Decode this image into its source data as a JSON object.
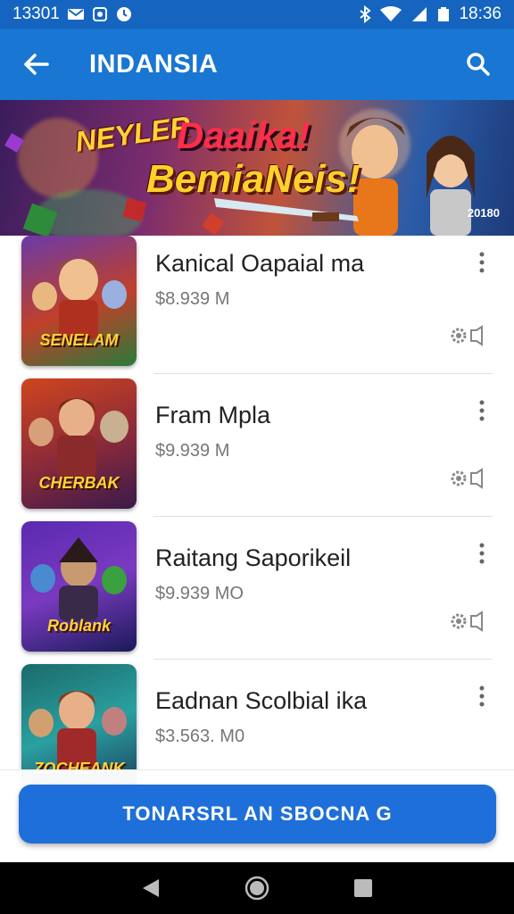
{
  "status_bar": {
    "time_left": "13301",
    "time_right": "18:36"
  },
  "app_bar": {
    "title": "INDANSIA"
  },
  "banner": {
    "tag_top": "NEYLER",
    "title_line1": "Daaika!",
    "title_line2": "BemiaNeis!",
    "corner_text": "20180"
  },
  "items": [
    {
      "title": "Kanical Oapaial ma",
      "price": "$8.939 M",
      "thumb_label": "SENELAM",
      "colors": [
        "#2a7a3a",
        "#6a3aa8"
      ]
    },
    {
      "title": "Fram Mpla",
      "price": "$9.939 M",
      "thumb_label": "CHERBAK",
      "colors": [
        "#d0451e",
        "#5a2a6a"
      ]
    },
    {
      "title": "Raitang Saporikeil",
      "price": "$9.939 MO",
      "thumb_label": "Roblank",
      "colors": [
        "#5a2ab0",
        "#1a1a5a"
      ]
    },
    {
      "title": "Eadnan Scolbial ika",
      "price": "$3.563. M0",
      "thumb_label": "ZOCHEANK",
      "colors": [
        "#1a6a6a",
        "#2aa0a0"
      ]
    }
  ],
  "cta": {
    "label": "TONARSRL AN SBOCNA G"
  },
  "colors": {
    "primary": "#1976d2",
    "status": "#1565c0",
    "cta": "#1e6fd9"
  }
}
